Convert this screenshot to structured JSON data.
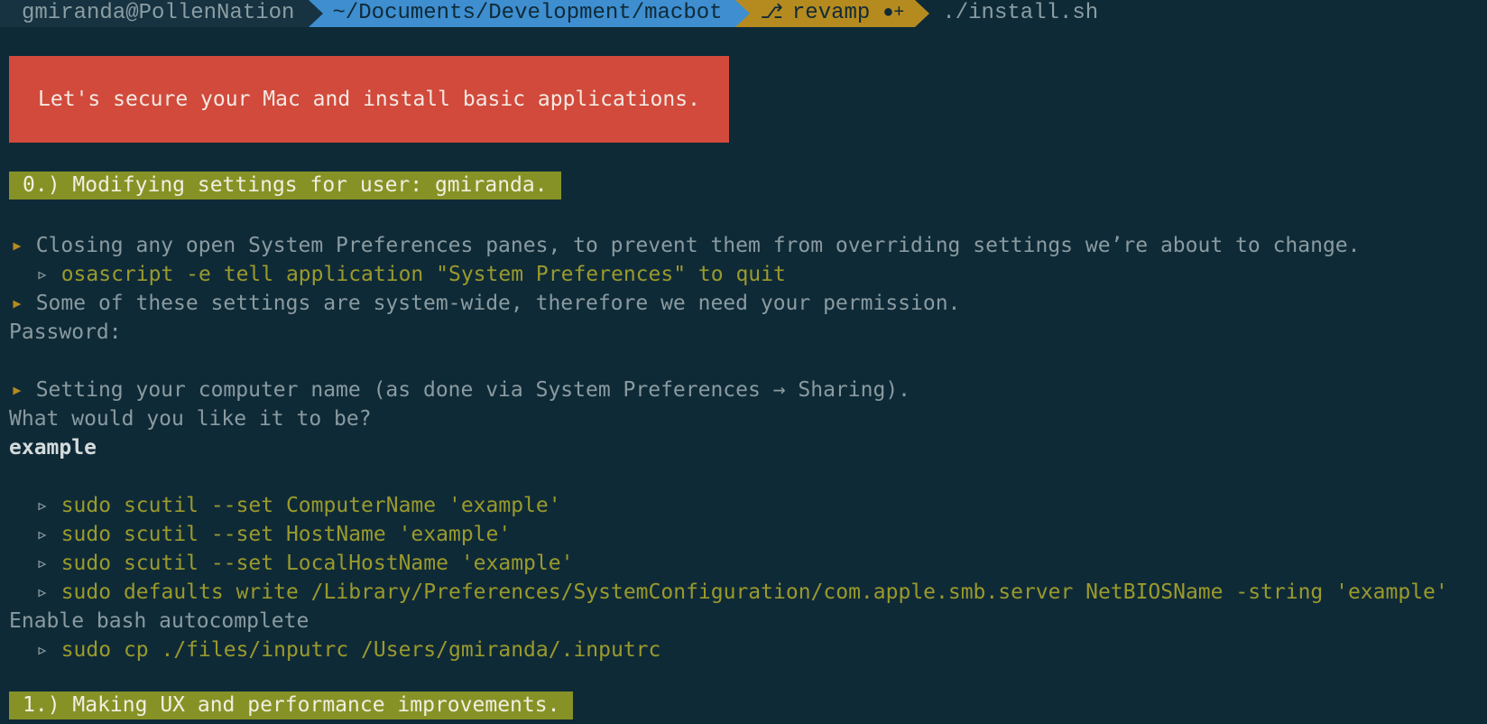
{
  "prompt": {
    "user_host": "gmiranda@PollenNation",
    "path": "~/Documents/Development/macbot",
    "branch": "revamp",
    "command": "./install.sh"
  },
  "banner": {
    "apple_glyphs": "        ",
    "title": "Let's secure your Mac and install basic applications."
  },
  "sections": [
    "0.) Modifying settings for user: gmiranda.",
    "1.) Making UX and performance improvements."
  ],
  "lines": {
    "l1": "▸ Closing any open System Preferences panes, to prevent them from overriding settings we’re about to change.",
    "l2": "▹ osascript -e tell application \"System Preferences\" to quit",
    "l3": "▸ Some of these settings are system-wide, therefore we need your permission.",
    "l4": "Password:",
    "l5": "▸ Setting your computer name (as done via System Preferences → Sharing).",
    "l6": "What would you like it to be?",
    "l7": "example",
    "l8": "▹ sudo scutil --set ComputerName 'example'",
    "l9": "▹ sudo scutil --set HostName 'example'",
    "l10": "▹ sudo scutil --set LocalHostName 'example'",
    "l11": "▹ sudo defaults write /Library/Preferences/SystemConfiguration/com.apple.smb.server NetBIOSName -string 'example'",
    "l12": "Enable bash autocomplete",
    "l13": "▹ sudo cp ./files/inputrc /Users/gmiranda/.inputrc"
  },
  "colors": {
    "background": "#0f2a37",
    "banner": "#d14a3c",
    "section": "#869226",
    "bullet": "#b58b1f",
    "command": "#9a9a2c",
    "path_segment": "#3e8ed0"
  }
}
